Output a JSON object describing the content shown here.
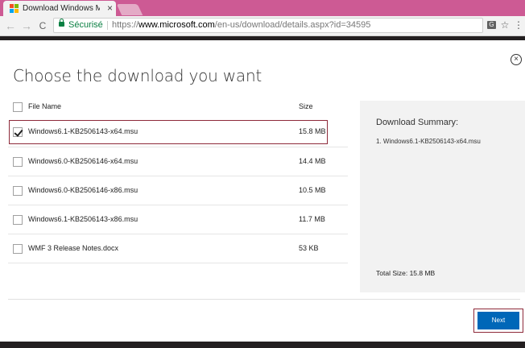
{
  "browser": {
    "tab_title": "Download Windows Mana",
    "tab_close": "×",
    "back_glyph": "←",
    "forward_glyph": "→",
    "reload_glyph": "C",
    "secure_label": "Sécurisé",
    "url_scheme": "https://",
    "url_host": "www.microsoft.com",
    "url_path": "/en-us/download/details.aspx?id=34595",
    "translate_glyph": "G",
    "star_glyph": "☆",
    "menu_glyph": "⋮"
  },
  "dialog": {
    "close_glyph": "×",
    "heading": "Choose the download you want",
    "col_filename": "File Name",
    "col_size": "Size",
    "files": [
      {
        "name": "Windows6.1-KB2506143-x64.msu",
        "size": "15.8 MB",
        "checked": true
      },
      {
        "name": "Windows6.0-KB2506146-x64.msu",
        "size": "14.4 MB",
        "checked": false
      },
      {
        "name": "Windows6.0-KB2506146-x86.msu",
        "size": "10.5 MB",
        "checked": false
      },
      {
        "name": "Windows6.1-KB2506143-x86.msu",
        "size": "11.7 MB",
        "checked": false
      },
      {
        "name": "WMF 3 Release Notes.docx",
        "size": "53 KB",
        "checked": false
      }
    ],
    "summary": {
      "title": "Download Summary:",
      "items": [
        "1. Windows6.1-KB2506143-x64.msu"
      ],
      "total": "Total Size: 15.8 MB"
    },
    "next_label": "Next"
  },
  "colors": {
    "accent": "#0067b8",
    "titlebar": "#cd5a94",
    "highlight_border": "#8e2a3a",
    "secure_green": "#0b8043"
  }
}
